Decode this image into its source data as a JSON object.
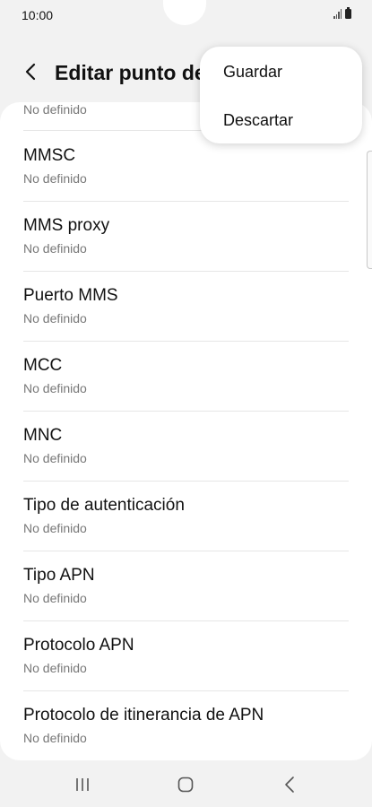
{
  "status_bar": {
    "time": "10:00",
    "signal_icon": "signal-icon",
    "battery_icon": "battery-icon"
  },
  "header": {
    "title": "Editar punto de",
    "back_icon": "back-arrow-icon"
  },
  "list": {
    "partial_value": "No definido",
    "items": [
      {
        "label": "MMSC",
        "value": "No definido"
      },
      {
        "label": "MMS proxy",
        "value": "No definido"
      },
      {
        "label": "Puerto MMS",
        "value": "No definido"
      },
      {
        "label": "MCC",
        "value": "No definido"
      },
      {
        "label": "MNC",
        "value": "No definido"
      },
      {
        "label": "Tipo de autenticación",
        "value": "No definido"
      },
      {
        "label": "Tipo APN",
        "value": "No definido"
      },
      {
        "label": "Protocolo APN",
        "value": "No definido"
      },
      {
        "label": "Protocolo de itinerancia de APN",
        "value": "No definido"
      }
    ]
  },
  "menu": {
    "save_label": "Guardar",
    "discard_label": "Descartar"
  },
  "nav_bar": {
    "recents_icon": "recents-icon",
    "home_icon": "home-icon",
    "back_icon": "nav-back-icon"
  }
}
